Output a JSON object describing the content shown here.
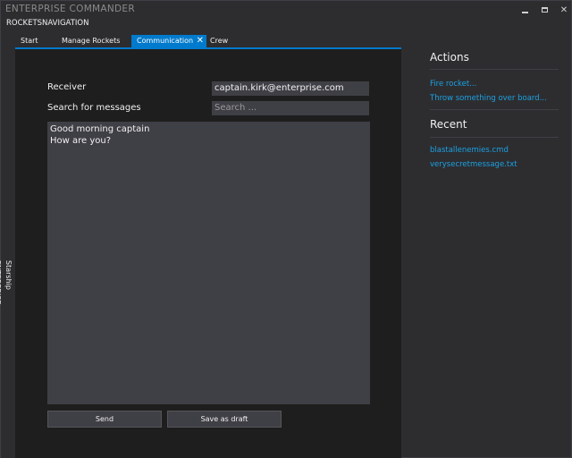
{
  "app": {
    "title": "ENTERPRISE COMMANDER"
  },
  "window_controls": {
    "minimize_icon": "minimize-icon",
    "maximize_icon": "maximize-icon",
    "close_icon": "close-icon"
  },
  "menu": {
    "items": [
      {
        "label": "ROCKETS"
      },
      {
        "label": "NAVIGATION"
      }
    ]
  },
  "tabs": [
    {
      "label": "Start"
    },
    {
      "label": "Manage Rockets"
    },
    {
      "label": "Communication",
      "active": true
    },
    {
      "label": "Crew"
    }
  ],
  "tab_close_glyph": "✕",
  "side_panel": {
    "label": "Starship ENTERPRISE"
  },
  "communication": {
    "receiver_label": "Receiver",
    "receiver_value": "captain.kirk@enterprise.com",
    "search_label": "Search for messages",
    "search_placeholder": "Search ...",
    "message_text": "Good morning captain\nHow are you?",
    "send_label": "Send",
    "draft_label": "Save as draft"
  },
  "actions": {
    "title": "Actions",
    "items": [
      {
        "label": "Fire rocket..."
      },
      {
        "label": "Throw something over board..."
      }
    ]
  },
  "recent": {
    "title": "Recent",
    "items": [
      {
        "label": "blastallenemies.cmd"
      },
      {
        "label": "verysecretmessage.txt"
      }
    ]
  },
  "colors": {
    "accent": "#007acc",
    "link": "#1ba1e2",
    "background": "#2d2d30",
    "content_background": "#1e1e1e",
    "field_background": "#3f3f46"
  }
}
